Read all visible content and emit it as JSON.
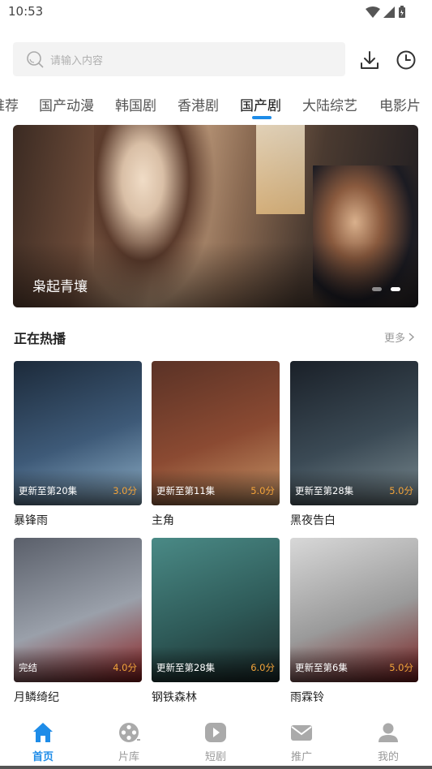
{
  "status_bar": {
    "time": "10:53"
  },
  "search": {
    "placeholder": "请输入内容"
  },
  "tabs": [
    {
      "label": "推荐",
      "active": false
    },
    {
      "label": "国产动漫",
      "active": false
    },
    {
      "label": "韩国剧",
      "active": false
    },
    {
      "label": "香港剧",
      "active": false
    },
    {
      "label": "国产剧",
      "active": true
    },
    {
      "label": "大陆综艺",
      "active": false
    },
    {
      "label": "电影片",
      "active": false
    }
  ],
  "banner": {
    "title": "枭起青壤",
    "slide_index": 2,
    "slide_count": 2
  },
  "section": {
    "title": "正在热播",
    "more_label": "更多"
  },
  "cards": [
    {
      "title": "暴锋雨",
      "update": "更新至第20集",
      "score": "3.0分",
      "colors": [
        "#1c2a3a",
        "#3e5a78",
        "#8fb0c8"
      ]
    },
    {
      "title": "主角",
      "update": "更新至第11集",
      "score": "5.0分",
      "colors": [
        "#5a3226",
        "#8b4a32",
        "#c69466"
      ]
    },
    {
      "title": "黑夜告白",
      "update": "更新至第28集",
      "score": "5.0分",
      "colors": [
        "#1a2028",
        "#3b4a55",
        "#7a8a90"
      ]
    },
    {
      "title": "月鳞绮纪",
      "update": "完结",
      "score": "4.0分",
      "colors": [
        "#5a5f6a",
        "#9aa0aa",
        "#8a1e1e"
      ]
    },
    {
      "title": "钢铁森林",
      "update": "更新至第28集",
      "score": "6.0分",
      "colors": [
        "#4a8a86",
        "#2e5a58",
        "#1c2a2a"
      ]
    },
    {
      "title": "雨霖铃",
      "update": "更新至第6集",
      "score": "5.0分",
      "colors": [
        "#d8d8d8",
        "#9a9a9a",
        "#7a1e1e"
      ]
    }
  ],
  "bottom_nav": [
    {
      "label": "首页",
      "icon": "home-icon",
      "active": true
    },
    {
      "label": "片库",
      "icon": "film-reel-icon",
      "active": false
    },
    {
      "label": "短剧",
      "icon": "play-icon",
      "active": false
    },
    {
      "label": "推广",
      "icon": "mail-icon",
      "active": false
    },
    {
      "label": "我的",
      "icon": "user-icon",
      "active": false
    }
  ],
  "colors": {
    "accent": "#1e8ce8",
    "score": "#f2a33a",
    "inactive": "#aaaaaa"
  }
}
